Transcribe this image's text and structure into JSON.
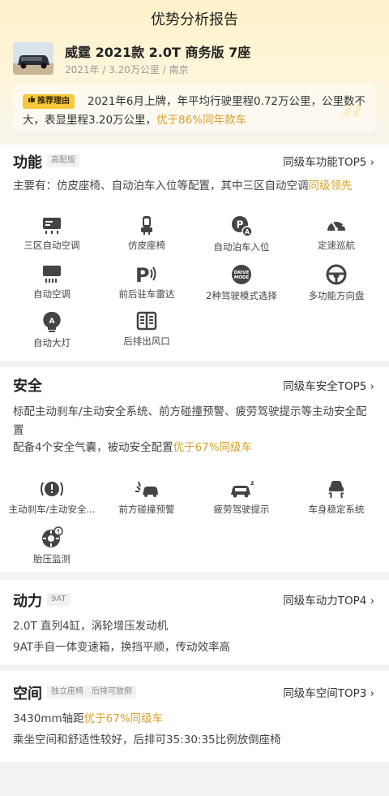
{
  "header": {
    "title": "优势分析报告"
  },
  "car": {
    "name": "威霆 2021款 2.0T 商务版 7座",
    "meta": "2021年 / 3.20万公里 / 南京",
    "reason_tag": "推荐理由",
    "reason_text": "2021年6月上牌，年平均行驶里程0.72万公里，公里数不大，表显里程3.20万公里，",
    "reason_highlight": "优于86%同年款车"
  },
  "function": {
    "title": "功能",
    "badge": "高配版",
    "link": "同级车功能TOP5 ›",
    "desc": "主要有：仿皮座椅、自动泊车入位等配置，其中三区自动空调",
    "desc_highlight": "同级领先",
    "items": [
      {
        "label": "三区自动空调",
        "icon": "ac-panel-icon"
      },
      {
        "label": "仿皮座椅",
        "icon": "seat-icon"
      },
      {
        "label": "自动泊车入位",
        "icon": "auto-park-icon"
      },
      {
        "label": "定速巡航",
        "icon": "cruise-icon"
      },
      {
        "label": "自动空调",
        "icon": "ac-icon"
      },
      {
        "label": "前后驻车雷达",
        "icon": "parking-radar-icon"
      },
      {
        "label": "2种驾驶模式选择",
        "icon": "drive-mode-icon"
      },
      {
        "label": "多功能方向盘",
        "icon": "steering-wheel-icon"
      },
      {
        "label": "自动大灯",
        "icon": "auto-headlight-icon"
      },
      {
        "label": "后排出风口",
        "icon": "rear-vent-icon"
      }
    ]
  },
  "safety": {
    "title": "安全",
    "link": "同级车安全TOP5 ›",
    "desc1": "标配主动刹车/主动安全系统、前方碰撞预警、疲劳驾驶提示等主动安全配置",
    "desc2": "配备4个安全气囊，被动安全配置",
    "desc2_highlight": "优于67%同级车",
    "items": [
      {
        "label": "主动刹车/主动安全...",
        "icon": "active-brake-icon"
      },
      {
        "label": "前方碰撞预警",
        "icon": "collision-warning-icon"
      },
      {
        "label": "疲劳驾驶提示",
        "icon": "fatigue-icon"
      },
      {
        "label": "车身稳定系统",
        "icon": "stability-icon"
      },
      {
        "label": "胎压监测",
        "icon": "tire-pressure-icon"
      }
    ]
  },
  "power": {
    "title": "动力",
    "badge": "9AT",
    "link": "同级车动力TOP4 ›",
    "line1": "2.0T 直列4缸，涡轮增压发动机",
    "line2": "9AT手自一体变速箱，换挡平顺，传动效率高"
  },
  "space": {
    "title": "空间",
    "badge1": "独立座椅",
    "badge2": "后排可放倒",
    "link": "同级车空间TOP3 ›",
    "line1": "3430mm轴距",
    "line1_highlight": "优于67%同级车",
    "line2": "乘坐空间和舒适性较好，后排可35:30:35比例放倒座椅"
  },
  "colors": {
    "accent": "#d8a12a",
    "tag": "#f7c93a",
    "hero": "#fdf1c9"
  }
}
